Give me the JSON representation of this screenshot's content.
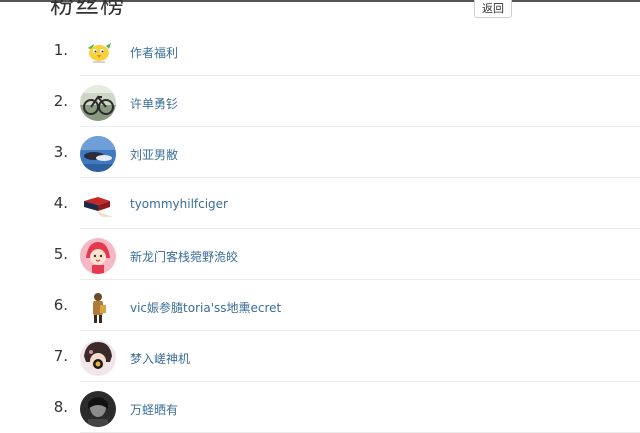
{
  "page": {
    "title": "粉丝榜",
    "back_label": "返回"
  },
  "fans": [
    {
      "rank": "1.",
      "name": "作者福利",
      "avatar_icon": "yellow-bird-avatar"
    },
    {
      "rank": "2.",
      "name": "许单勇钐",
      "avatar_icon": "bicycle-photo-avatar"
    },
    {
      "rank": "3.",
      "name": "刘亚男敝",
      "avatar_icon": "blue-sky-avatar"
    },
    {
      "rank": "4.",
      "name": "tyommyhilfciger",
      "avatar_icon": "red-box-avatar"
    },
    {
      "rank": "5.",
      "name": "新龙门客栈菀野洈皎",
      "avatar_icon": "pink-cartoon-girl-avatar"
    },
    {
      "rank": "6.",
      "name": "vic娠参膸toria'ss地熏ecret",
      "avatar_icon": "standing-figure-avatar"
    },
    {
      "rank": "7.",
      "name": "梦入嵯神机",
      "avatar_icon": "round-face-avatar"
    },
    {
      "rank": "8.",
      "name": "万蛏晒有",
      "avatar_icon": "dark-portrait-avatar"
    }
  ]
}
